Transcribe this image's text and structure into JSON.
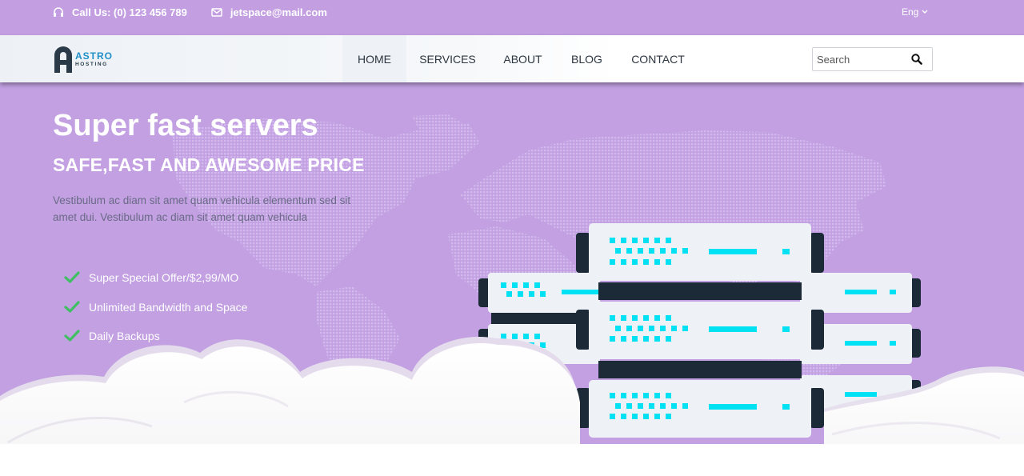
{
  "topbar": {
    "phone_icon": "headset-icon",
    "phone": "Call Us: (0) 123 456 789",
    "email_icon": "envelope-icon",
    "email": "jetspace@mail.com",
    "language": "Eng",
    "language_icon": "chevron-down-icon"
  },
  "brand": {
    "word1": "ASTRO",
    "word2": "HOSTING",
    "color_primary": "#1e8fc7",
    "color_dark": "#2a3a48"
  },
  "nav": {
    "items": [
      {
        "label": "HOME",
        "active": true
      },
      {
        "label": "SERVICES",
        "active": false
      },
      {
        "label": "ABOUT",
        "active": false
      },
      {
        "label": "BLOG",
        "active": false
      },
      {
        "label": "CONTACT",
        "active": false
      }
    ],
    "search_placeholder": "Search",
    "search_value": "",
    "search_icon": "search-icon"
  },
  "hero": {
    "title": "Super fast servers",
    "subtitle": "SAFE,FAST AND AWESOME PRICE",
    "description": "Vestibulum ac diam sit amet quam vehicula elementum sed sit amet dui. Vestibulum ac diam sit amet quam vehicula",
    "features": [
      "Super Special Offer/$2,99/MO",
      "Unlimited Bandwidth and Space",
      "Daily Backups"
    ],
    "feature_icon": "check-icon"
  },
  "colors": {
    "accent_purple": "#c2a0e2",
    "topbar_purple": "#c39fe2",
    "check_green": "#3fbf62",
    "server_cyan": "#00e1f3",
    "server_dark": "#1b2a36",
    "server_panel": "#eef1f5"
  },
  "illustration": {
    "world_map": "world-map-dots",
    "servers": "server-rack-stack",
    "clouds": "cloud-shapes"
  }
}
